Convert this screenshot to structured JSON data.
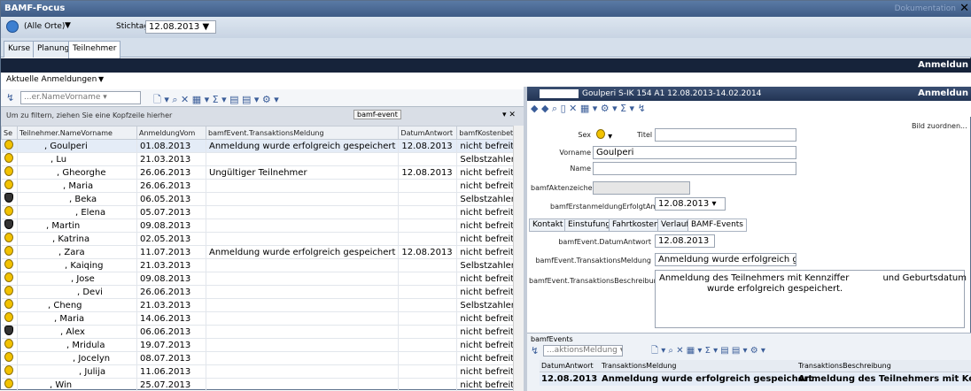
{
  "window": {
    "title": "BAMF-Focus",
    "doc_label": "Dokumentation"
  },
  "filter": {
    "location": "(Alle Orte)",
    "stichtag_label": "Stichtag",
    "stichtag_value": "12.08.2013"
  },
  "tabs": [
    "Kurse",
    "Planung",
    "Teilnehmer"
  ],
  "header_right": "Anmeldun",
  "view": {
    "selector": "Aktuelle Anmeldungen"
  },
  "left_toolbar": {
    "field_combo": "...er.NameVorname"
  },
  "grouping": {
    "hint": "Um zu filtern, ziehen Sie eine Kopfzeile hierher",
    "group_chip": "bamf-event"
  },
  "grid": {
    "columns": [
      "Se",
      "Teilnehmer.NameVorname",
      "AnmeldungVom",
      "bamfEvent.TransaktionsMeldung",
      "DatumAntwort",
      "bamfKostenbete"
    ],
    "rows": [
      {
        "icon": "f",
        "name": ", Goulperi",
        "vom": "01.08.2013",
        "meldung": "Anmeldung wurde erfolgreich gespeichert",
        "datum": "12.08.2013",
        "kosten": "nicht befreit",
        "sel": true
      },
      {
        "icon": "f",
        "name": ", Lu",
        "vom": "21.03.2013",
        "meldung": "",
        "datum": "",
        "kosten": "Selbstzahler"
      },
      {
        "icon": "f",
        "name": ", Gheorghe",
        "vom": "26.06.2013",
        "meldung": "Ungültiger Teilnehmer",
        "datum": "12.08.2013",
        "kosten": "nicht befreit"
      },
      {
        "icon": "f",
        "name": ", Maria",
        "vom": "26.06.2013",
        "meldung": "",
        "datum": "",
        "kosten": "nicht befreit"
      },
      {
        "icon": "m",
        "name": ", Beka",
        "vom": "06.05.2013",
        "meldung": "",
        "datum": "",
        "kosten": "Selbstzahler"
      },
      {
        "icon": "f",
        "name": ", Elena",
        "vom": "05.07.2013",
        "meldung": "",
        "datum": "",
        "kosten": "nicht befreit"
      },
      {
        "icon": "m",
        "name": ", Martin",
        "vom": "09.08.2013",
        "meldung": "",
        "datum": "",
        "kosten": "nicht befreit"
      },
      {
        "icon": "f",
        "name": ", Katrina",
        "vom": "02.05.2013",
        "meldung": "",
        "datum": "",
        "kosten": "nicht befreit"
      },
      {
        "icon": "f",
        "name": ", Zara",
        "vom": "11.07.2013",
        "meldung": "Anmeldung wurde erfolgreich gespeichert",
        "datum": "12.08.2013",
        "kosten": "nicht befreit"
      },
      {
        "icon": "f",
        "name": ", Kaiqing",
        "vom": "21.03.2013",
        "meldung": "",
        "datum": "",
        "kosten": "Selbstzahler"
      },
      {
        "icon": "f",
        "name": ", Jose",
        "vom": "09.08.2013",
        "meldung": "",
        "datum": "",
        "kosten": "nicht befreit"
      },
      {
        "icon": "f",
        "name": ", Devi",
        "vom": "26.06.2013",
        "meldung": "",
        "datum": "",
        "kosten": "nicht befreit"
      },
      {
        "icon": "f",
        "name": ", Cheng",
        "vom": "21.03.2013",
        "meldung": "",
        "datum": "",
        "kosten": "Selbstzahler"
      },
      {
        "icon": "f",
        "name": ", Maria",
        "vom": "14.06.2013",
        "meldung": "",
        "datum": "",
        "kosten": "nicht befreit"
      },
      {
        "icon": "m",
        "name": ", Alex",
        "vom": "06.06.2013",
        "meldung": "",
        "datum": "",
        "kosten": "nicht befreit"
      },
      {
        "icon": "f",
        "name": ", Mridula",
        "vom": "19.07.2013",
        "meldung": "",
        "datum": "",
        "kosten": "nicht befreit"
      },
      {
        "icon": "f",
        "name": ", Jocelyn",
        "vom": "08.07.2013",
        "meldung": "",
        "datum": "",
        "kosten": "nicht befreit"
      },
      {
        "icon": "f",
        "name": ", Julija",
        "vom": "11.06.2013",
        "meldung": "",
        "datum": "",
        "kosten": "nicht befreit"
      },
      {
        "icon": "f",
        "name": ", Win",
        "vom": "25.07.2013",
        "meldung": "",
        "datum": "",
        "kosten": "nicht befreit"
      }
    ]
  },
  "detail": {
    "header": "Goulperi  S-IK 154 A1  12.08.2013-14.02.2014",
    "header_right": "Anmeldun",
    "bild": "Bild zuordnen...",
    "sex_label": "Sex",
    "titel_label": "Titel",
    "vorname_label": "Vorname",
    "vorname_value": "Goulperi",
    "name_label": "Name",
    "aktenzeichen_label": "bamfAktenzeichen",
    "erstanmeldung_label": "bamfErstanmeldungErfolgtAm",
    "erstanmeldung_value": "12.08.2013",
    "tabs": [
      "Kontakt",
      "Einstufung",
      "Fahrtkosten",
      "Verlauf",
      "BAMF-Events"
    ],
    "datum_label": "bamfEvent.DatumAntwort",
    "datum_value": "12.08.2013",
    "meldung_label": "bamfEvent.TransaktionsMeldung",
    "meldung_value": "Anmeldung wurde erfolgreich gesp",
    "beschreibung_label": "bamfEvent.TransaktionsBeschreibung",
    "beschreibung_line1": "Anmeldung des Teilnehmers mit Kennziffer            und Geburtsdatum",
    "beschreibung_line2": "wurde erfolgreich gespeichert."
  },
  "events": {
    "title": "bamfEvents",
    "combo": "...aktionsMeldung",
    "columns": [
      "DatumAntwort",
      "TransaktionsMeldung",
      "TransaktionsBeschreibung"
    ],
    "row": {
      "datum": "12.08.2013",
      "meldung": "Anmeldung wurde erfolgreich gespeichert",
      "beschreibung": "Anmeldung des Teilnehmers mit Kennzif"
    }
  }
}
